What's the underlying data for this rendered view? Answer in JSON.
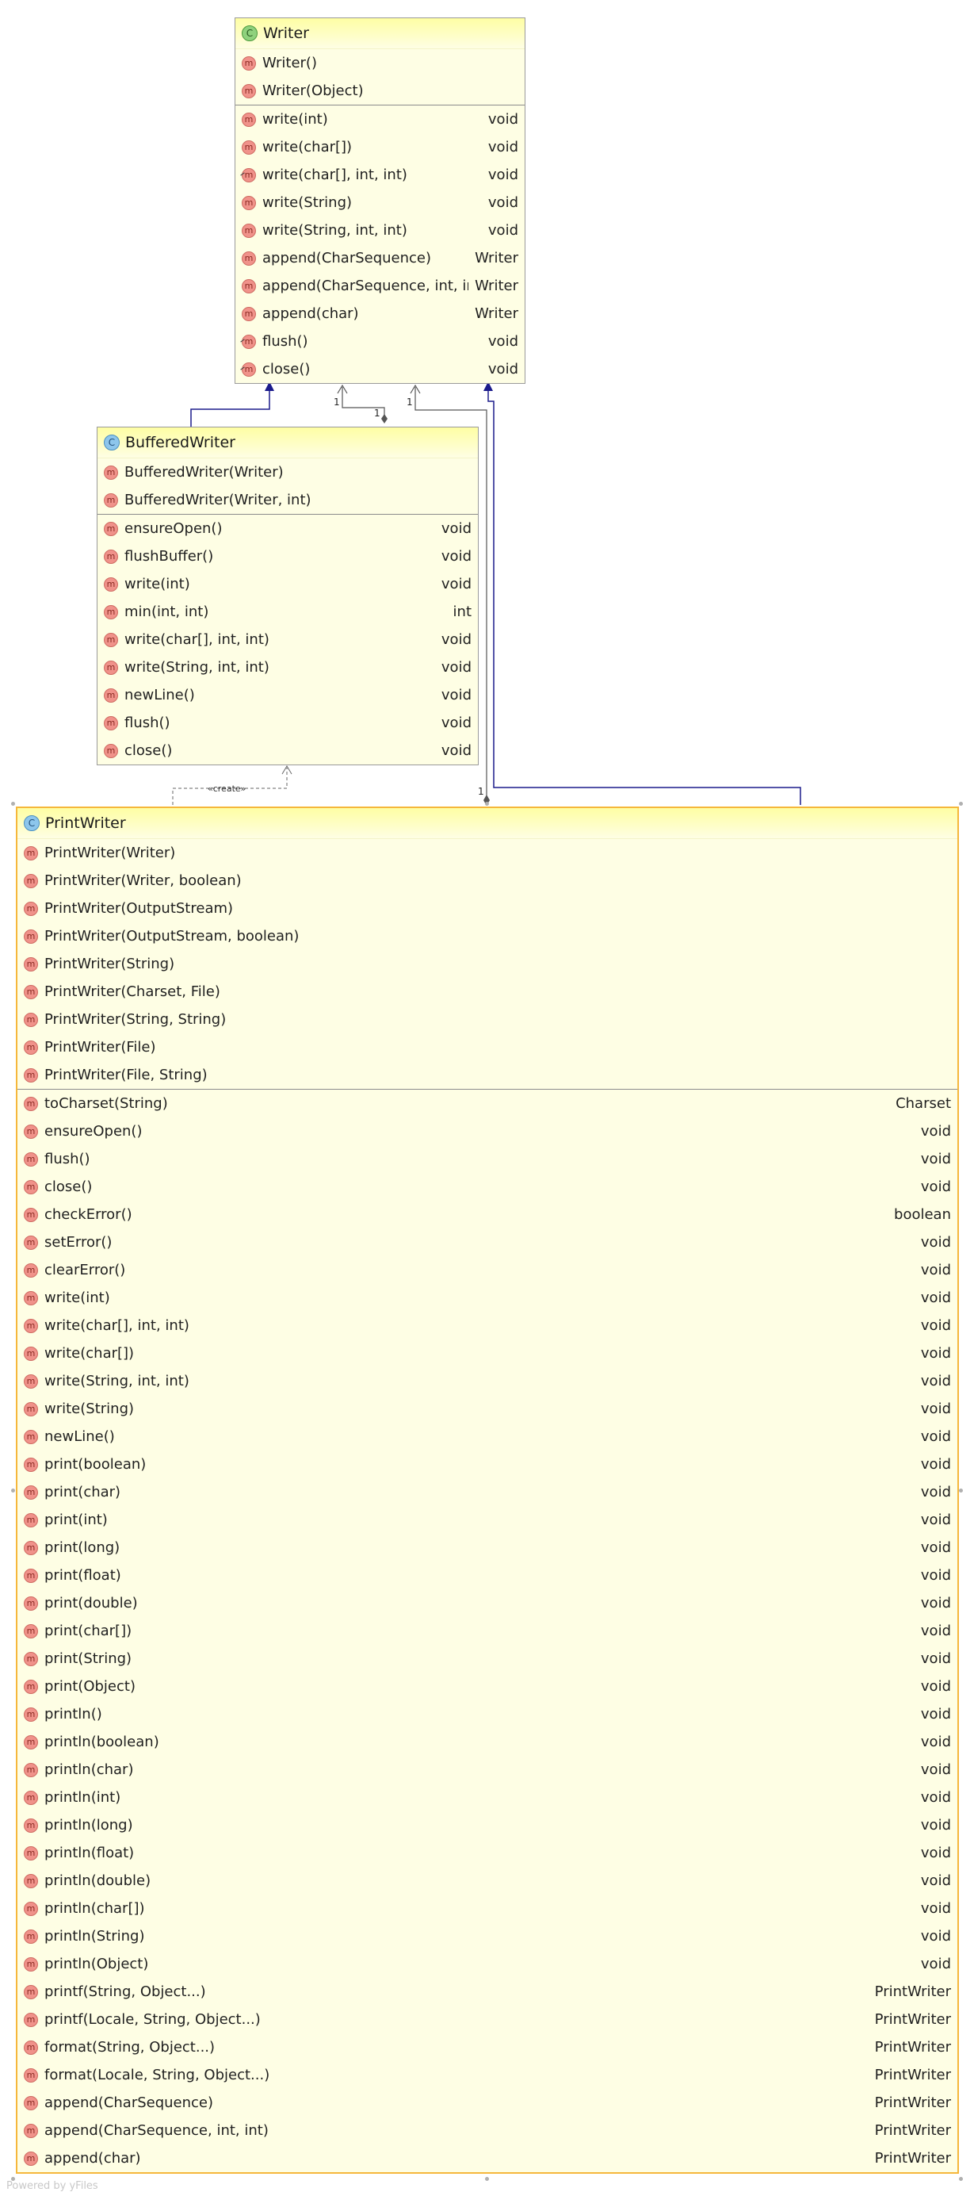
{
  "classes": {
    "writer": {
      "name": "Writer",
      "icon": "abstract-class-icon",
      "constructors": [
        {
          "name": "Writer()"
        },
        {
          "name": "Writer(Object)"
        }
      ],
      "methods": [
        {
          "name": "write(int)",
          "type": "void",
          "abstract": false
        },
        {
          "name": "write(char[])",
          "type": "void",
          "abstract": false
        },
        {
          "name": "write(char[], int, int)",
          "type": "void",
          "abstract": true
        },
        {
          "name": "write(String)",
          "type": "void",
          "abstract": false
        },
        {
          "name": "write(String, int, int)",
          "type": "void",
          "abstract": false
        },
        {
          "name": "append(CharSequence)",
          "type": "Writer",
          "abstract": false
        },
        {
          "name": "append(CharSequence, int, int)",
          "type": "Writer",
          "abstract": false
        },
        {
          "name": "append(char)",
          "type": "Writer",
          "abstract": false
        },
        {
          "name": "flush()",
          "type": "void",
          "abstract": true
        },
        {
          "name": "close()",
          "type": "void",
          "abstract": true
        }
      ]
    },
    "buffered_writer": {
      "name": "BufferedWriter",
      "icon": "class-icon",
      "constructors": [
        {
          "name": "BufferedWriter(Writer)"
        },
        {
          "name": "BufferedWriter(Writer, int)"
        }
      ],
      "methods": [
        {
          "name": "ensureOpen()",
          "type": "void"
        },
        {
          "name": "flushBuffer()",
          "type": "void"
        },
        {
          "name": "write(int)",
          "type": "void"
        },
        {
          "name": "min(int, int)",
          "type": "int"
        },
        {
          "name": "write(char[], int, int)",
          "type": "void"
        },
        {
          "name": "write(String, int, int)",
          "type": "void"
        },
        {
          "name": "newLine()",
          "type": "void"
        },
        {
          "name": "flush()",
          "type": "void"
        },
        {
          "name": "close()",
          "type": "void"
        }
      ]
    },
    "print_writer": {
      "name": "PrintWriter",
      "icon": "class-icon",
      "constructors": [
        {
          "name": "PrintWriter(Writer)"
        },
        {
          "name": "PrintWriter(Writer, boolean)"
        },
        {
          "name": "PrintWriter(OutputStream)"
        },
        {
          "name": "PrintWriter(OutputStream, boolean)"
        },
        {
          "name": "PrintWriter(String)"
        },
        {
          "name": "PrintWriter(Charset, File)"
        },
        {
          "name": "PrintWriter(String, String)"
        },
        {
          "name": "PrintWriter(File)"
        },
        {
          "name": "PrintWriter(File, String)"
        }
      ],
      "methods": [
        {
          "name": "toCharset(String)",
          "type": "Charset",
          "static": true
        },
        {
          "name": "ensureOpen()",
          "type": "void"
        },
        {
          "name": "flush()",
          "type": "void"
        },
        {
          "name": "close()",
          "type": "void"
        },
        {
          "name": "checkError()",
          "type": "boolean"
        },
        {
          "name": "setError()",
          "type": "void"
        },
        {
          "name": "clearError()",
          "type": "void"
        },
        {
          "name": "write(int)",
          "type": "void"
        },
        {
          "name": "write(char[], int, int)",
          "type": "void"
        },
        {
          "name": "write(char[])",
          "type": "void"
        },
        {
          "name": "write(String, int, int)",
          "type": "void"
        },
        {
          "name": "write(String)",
          "type": "void"
        },
        {
          "name": "newLine()",
          "type": "void"
        },
        {
          "name": "print(boolean)",
          "type": "void"
        },
        {
          "name": "print(char)",
          "type": "void"
        },
        {
          "name": "print(int)",
          "type": "void"
        },
        {
          "name": "print(long)",
          "type": "void"
        },
        {
          "name": "print(float)",
          "type": "void"
        },
        {
          "name": "print(double)",
          "type": "void"
        },
        {
          "name": "print(char[])",
          "type": "void"
        },
        {
          "name": "print(String)",
          "type": "void"
        },
        {
          "name": "print(Object)",
          "type": "void"
        },
        {
          "name": "println()",
          "type": "void"
        },
        {
          "name": "println(boolean)",
          "type": "void"
        },
        {
          "name": "println(char)",
          "type": "void"
        },
        {
          "name": "println(int)",
          "type": "void"
        },
        {
          "name": "println(long)",
          "type": "void"
        },
        {
          "name": "println(float)",
          "type": "void"
        },
        {
          "name": "println(double)",
          "type": "void"
        },
        {
          "name": "println(char[])",
          "type": "void"
        },
        {
          "name": "println(String)",
          "type": "void"
        },
        {
          "name": "println(Object)",
          "type": "void"
        },
        {
          "name": "printf(String, Object...)",
          "type": "PrintWriter"
        },
        {
          "name": "printf(Locale, String, Object...)",
          "type": "PrintWriter"
        },
        {
          "name": "format(String, Object...)",
          "type": "PrintWriter"
        },
        {
          "name": "format(Locale, String, Object...)",
          "type": "PrintWriter"
        },
        {
          "name": "append(CharSequence)",
          "type": "PrintWriter"
        },
        {
          "name": "append(CharSequence, int, int)",
          "type": "PrintWriter"
        },
        {
          "name": "append(char)",
          "type": "PrintWriter"
        }
      ]
    }
  },
  "relations": {
    "multiplicity_bw_out": "1",
    "multiplicity_bw_lock": "1",
    "multiplicity_pw_out": "1",
    "multiplicity_pw_lock": "1",
    "create_label": "«create»"
  },
  "colors": {
    "inheritance": "#1b1b8c",
    "association": "#555555",
    "selection": "#f5b73b",
    "class_fill": "#fefee4"
  },
  "footer": "Powered by yFiles"
}
